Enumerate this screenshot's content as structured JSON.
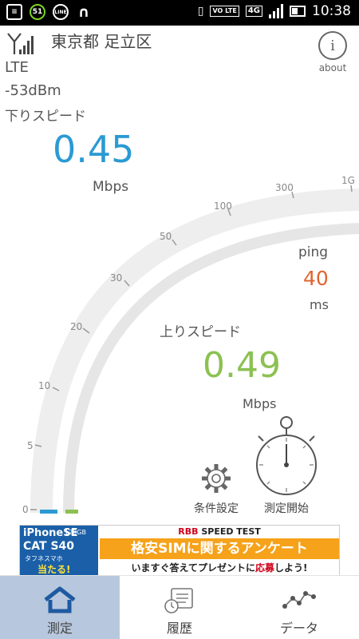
{
  "status_bar": {
    "notification_count": "51",
    "line_label": "LINE",
    "volte_label": "VO LTE",
    "network_badge": "4G",
    "time": "10:38"
  },
  "header": {
    "location": "東京都 足立区",
    "network_type": "LTE",
    "signal_strength": "-53dBm",
    "about_icon_glyph": "i",
    "about_label": "about"
  },
  "download": {
    "label": "下りスピード",
    "value": "0.45",
    "unit": "Mbps",
    "color": "#2b9ad3"
  },
  "ping": {
    "label": "ping",
    "value": "40",
    "unit": "ms",
    "color": "#e0642f"
  },
  "upload": {
    "label": "上りスピード",
    "value": "0.49",
    "unit": "Mbps",
    "color": "#8cc152"
  },
  "gauge": {
    "tick_labels": [
      "0",
      "5",
      "10",
      "20",
      "30",
      "50",
      "100",
      "300",
      "1G"
    ],
    "download_fill": 0.0,
    "upload_fill": 0.0
  },
  "actions": {
    "settings_label": "条件設定",
    "start_label": "測定開始",
    "settings_icon": "gear-icon",
    "start_icon": "stopwatch-icon"
  },
  "ad": {
    "left_line1": "iPhoneSE",
    "left_line1_small": "128GB",
    "left_line2": "CAT S40",
    "left_line3": "タフネスマホ",
    "left_line4": "当たる!",
    "brand_prefix": "RBB",
    "brand_suffix": " SPEED TEST",
    "headline": "格安SIMに関するアンケート",
    "sub_text_before": "いますぐ答えてプレゼントに",
    "sub_text_highlight": "応募",
    "sub_text_after": "しよう!"
  },
  "nav": {
    "tabs": [
      {
        "label": "測定",
        "icon": "home-icon",
        "active": true
      },
      {
        "label": "履歴",
        "icon": "history-icon",
        "active": false
      },
      {
        "label": "データ",
        "icon": "chart-icon",
        "active": false
      }
    ]
  }
}
